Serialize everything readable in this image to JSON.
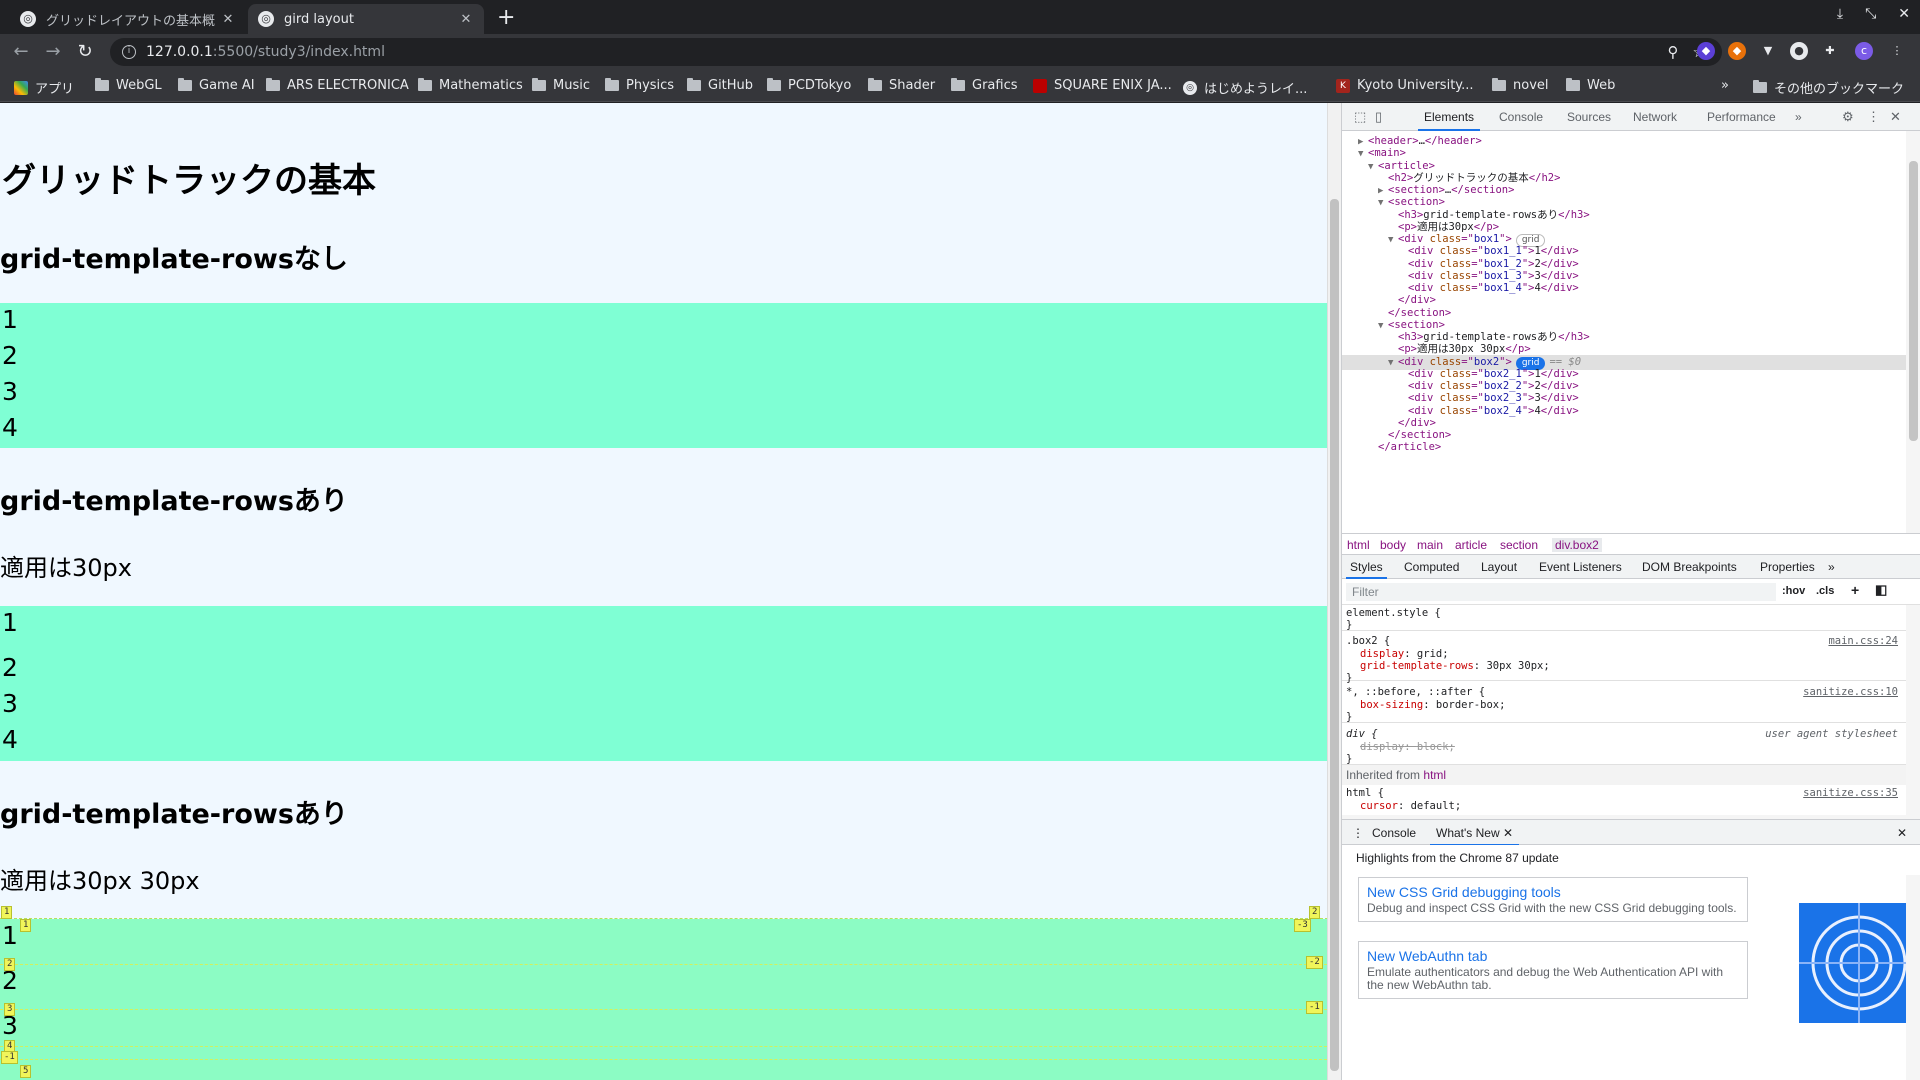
{
  "browser": {
    "tabs": [
      {
        "title": "グリッドレイアウトの基本概",
        "active": false
      },
      {
        "title": "gird layout",
        "active": true
      }
    ],
    "address": {
      "host": "127.0.0.1",
      "path": ":5500/study3/index.html"
    },
    "bookmarks": [
      "アプリ",
      "WebGL",
      "Game AI",
      "ARS ELECTRONICA",
      "Mathematics",
      "Music",
      "Physics",
      "GitHub",
      "PCDTokyo",
      "Shader",
      "Grafics",
      "SQUARE ENIX JA...",
      "はじめようレイ...",
      "Kyoto University...",
      "novel",
      "Web"
    ],
    "other_bookmarks": "その他のブックマーク",
    "overflow": "»",
    "profile_initial": "c"
  },
  "page": {
    "heading": "グリッドトラックの基本",
    "sections": [
      {
        "title": "grid-template-rowsなし",
        "note": "",
        "items": [
          "1",
          "2",
          "3",
          "4"
        ]
      },
      {
        "title": "grid-template-rowsあり",
        "note": "適用は30px",
        "items": [
          "1",
          "2",
          "3",
          "4"
        ]
      },
      {
        "title": "grid-template-rowsあり",
        "note": "適用は30px 30px",
        "items": [
          "1",
          "2",
          "3",
          "4"
        ]
      }
    ],
    "grid_overlay": {
      "row_badges_left": [
        "1",
        "2",
        "3",
        "4",
        "-1",
        "5"
      ],
      "row_badges_right": [
        "-3",
        "-2",
        "-1"
      ],
      "col_badges": [
        "1",
        "2"
      ],
      "inner_badge": "1"
    }
  },
  "devtools": {
    "tabs": [
      "Elements",
      "Console",
      "Sources",
      "Network",
      "Performance"
    ],
    "active_tab": "Elements",
    "more": "»",
    "dom": [
      {
        "indent": 2,
        "tri": "▶",
        "parts": [
          [
            "tag",
            "<header>"
          ],
          [
            "txt",
            "…"
          ],
          [
            "tag",
            "</header>"
          ]
        ]
      },
      {
        "indent": 2,
        "tri": "▼",
        "parts": [
          [
            "tag",
            "<main>"
          ]
        ]
      },
      {
        "indent": 3,
        "tri": "▼",
        "parts": [
          [
            "tag",
            "<article>"
          ]
        ]
      },
      {
        "indent": 4,
        "tri": "",
        "parts": [
          [
            "tag",
            "<h2>"
          ],
          [
            "txt",
            "グリッドトラックの基本"
          ],
          [
            "tag",
            "</h2>"
          ]
        ]
      },
      {
        "indent": 4,
        "tri": "▶",
        "parts": [
          [
            "tag",
            "<section>"
          ],
          [
            "txt",
            "…"
          ],
          [
            "tag",
            "</section>"
          ]
        ]
      },
      {
        "indent": 4,
        "tri": "▼",
        "parts": [
          [
            "tag",
            "<section>"
          ]
        ]
      },
      {
        "indent": 5,
        "tri": "",
        "parts": [
          [
            "tag",
            "<h3>"
          ],
          [
            "txt",
            "grid-template-rowsあり"
          ],
          [
            "tag",
            "</h3>"
          ]
        ]
      },
      {
        "indent": 5,
        "tri": "",
        "parts": [
          [
            "tag",
            "<p>"
          ],
          [
            "txt",
            "適用は30px"
          ],
          [
            "tag",
            "</p>"
          ]
        ]
      },
      {
        "indent": 5,
        "tri": "▼",
        "parts": [
          [
            "tag",
            "<div "
          ],
          [
            "attr",
            "class"
          ],
          [
            "tag",
            "=\""
          ],
          [
            "aval",
            "box1"
          ],
          [
            "tag",
            "\">"
          ]
        ],
        "pill": "grid"
      },
      {
        "indent": 6,
        "tri": "",
        "parts": [
          [
            "tag",
            "<div "
          ],
          [
            "attr",
            "class"
          ],
          [
            "tag",
            "=\""
          ],
          [
            "aval",
            "box1_1"
          ],
          [
            "tag",
            "\">"
          ],
          [
            "txt",
            "1"
          ],
          [
            "tag",
            "</div>"
          ]
        ]
      },
      {
        "indent": 6,
        "tri": "",
        "parts": [
          [
            "tag",
            "<div "
          ],
          [
            "attr",
            "class"
          ],
          [
            "tag",
            "=\""
          ],
          [
            "aval",
            "box1_2"
          ],
          [
            "tag",
            "\">"
          ],
          [
            "txt",
            "2"
          ],
          [
            "tag",
            "</div>"
          ]
        ]
      },
      {
        "indent": 6,
        "tri": "",
        "parts": [
          [
            "tag",
            "<div "
          ],
          [
            "attr",
            "class"
          ],
          [
            "tag",
            "=\""
          ],
          [
            "aval",
            "box1_3"
          ],
          [
            "tag",
            "\">"
          ],
          [
            "txt",
            "3"
          ],
          [
            "tag",
            "</div>"
          ]
        ]
      },
      {
        "indent": 6,
        "tri": "",
        "parts": [
          [
            "tag",
            "<div "
          ],
          [
            "attr",
            "class"
          ],
          [
            "tag",
            "=\""
          ],
          [
            "aval",
            "box1_4"
          ],
          [
            "tag",
            "\">"
          ],
          [
            "txt",
            "4"
          ],
          [
            "tag",
            "</div>"
          ]
        ]
      },
      {
        "indent": 5,
        "tri": "",
        "parts": [
          [
            "tag",
            "</div>"
          ]
        ]
      },
      {
        "indent": 4,
        "tri": "",
        "parts": [
          [
            "tag",
            "</section>"
          ]
        ]
      },
      {
        "indent": 4,
        "tri": "▼",
        "parts": [
          [
            "tag",
            "<section>"
          ]
        ]
      },
      {
        "indent": 5,
        "tri": "",
        "parts": [
          [
            "tag",
            "<h3>"
          ],
          [
            "txt",
            "grid-template-rowsあり"
          ],
          [
            "tag",
            "</h3>"
          ]
        ]
      },
      {
        "indent": 5,
        "tri": "",
        "parts": [
          [
            "tag",
            "<p>"
          ],
          [
            "txt",
            "適用は30px 30px"
          ],
          [
            "tag",
            "</p>"
          ]
        ]
      },
      {
        "indent": 5,
        "tri": "▼",
        "parts": [
          [
            "tag",
            "<div "
          ],
          [
            "attr",
            "class"
          ],
          [
            "tag",
            "=\""
          ],
          [
            "aval",
            "box2"
          ],
          [
            "tag",
            "\">"
          ]
        ],
        "pill": "grid",
        "pill_on": true,
        "eq": "== $0",
        "selected": true
      },
      {
        "indent": 6,
        "tri": "",
        "parts": [
          [
            "tag",
            "<div "
          ],
          [
            "attr",
            "class"
          ],
          [
            "tag",
            "=\""
          ],
          [
            "aval",
            "box2_1"
          ],
          [
            "tag",
            "\">"
          ],
          [
            "txt",
            "1"
          ],
          [
            "tag",
            "</div>"
          ]
        ]
      },
      {
        "indent": 6,
        "tri": "",
        "parts": [
          [
            "tag",
            "<div "
          ],
          [
            "attr",
            "class"
          ],
          [
            "tag",
            "=\""
          ],
          [
            "aval",
            "box2_2"
          ],
          [
            "tag",
            "\">"
          ],
          [
            "txt",
            "2"
          ],
          [
            "tag",
            "</div>"
          ]
        ]
      },
      {
        "indent": 6,
        "tri": "",
        "parts": [
          [
            "tag",
            "<div "
          ],
          [
            "attr",
            "class"
          ],
          [
            "tag",
            "=\""
          ],
          [
            "aval",
            "box2_3"
          ],
          [
            "tag",
            "\">"
          ],
          [
            "txt",
            "3"
          ],
          [
            "tag",
            "</div>"
          ]
        ]
      },
      {
        "indent": 6,
        "tri": "",
        "parts": [
          [
            "tag",
            "<div "
          ],
          [
            "attr",
            "class"
          ],
          [
            "tag",
            "=\""
          ],
          [
            "aval",
            "box2_4"
          ],
          [
            "tag",
            "\">"
          ],
          [
            "txt",
            "4"
          ],
          [
            "tag",
            "</div>"
          ]
        ]
      },
      {
        "indent": 5,
        "tri": "",
        "parts": [
          [
            "tag",
            "</div>"
          ]
        ]
      },
      {
        "indent": 4,
        "tri": "",
        "parts": [
          [
            "tag",
            "</section>"
          ]
        ]
      },
      {
        "indent": 3,
        "tri": "",
        "parts": [
          [
            "tag",
            "</article>"
          ]
        ]
      }
    ],
    "breadcrumbs": [
      "html",
      "body",
      "main",
      "article",
      "section",
      "div.box2"
    ],
    "style_tabs": [
      "Styles",
      "Computed",
      "Layout",
      "Event Listeners",
      "DOM Breakpoints",
      "Properties"
    ],
    "filter_placeholder": "Filter",
    "filter_buttons": [
      ":hov",
      ".cls",
      "+"
    ],
    "rules": {
      "element_style": "element.style {",
      "box2": {
        "selector": ".box2 {",
        "source": "main.css:24",
        "props": [
          [
            "display",
            "grid;"
          ],
          [
            "grid-template-rows",
            "30px 30px;"
          ]
        ]
      },
      "universal": {
        "selector": "*, ::before, ::after {",
        "source": "sanitize.css:10",
        "props": [
          [
            "box-sizing",
            "border-box;"
          ]
        ]
      },
      "div": {
        "selector": "div {",
        "source": "user agent stylesheet",
        "props": [
          [
            "display",
            "block;"
          ]
        ]
      },
      "inherited_label": "Inherited from",
      "inherited_tag": "html",
      "html": {
        "selector": "html {",
        "source": "sanitize.css:35",
        "props": [
          [
            "cursor",
            "default;"
          ]
        ]
      },
      "close_brace": "}"
    },
    "drawer": {
      "tabs": [
        "Console",
        "What's New"
      ],
      "active": "What's New",
      "highlights": "Highlights from the Chrome 87 update",
      "cards": [
        {
          "title": "New CSS Grid debugging tools",
          "desc": "Debug and inspect CSS Grid with the new CSS Grid debugging tools."
        },
        {
          "title": "New WebAuthn tab",
          "desc": "Emulate authenticators and debug the Web Authentication API with the new WebAuthn tab."
        }
      ]
    }
  }
}
